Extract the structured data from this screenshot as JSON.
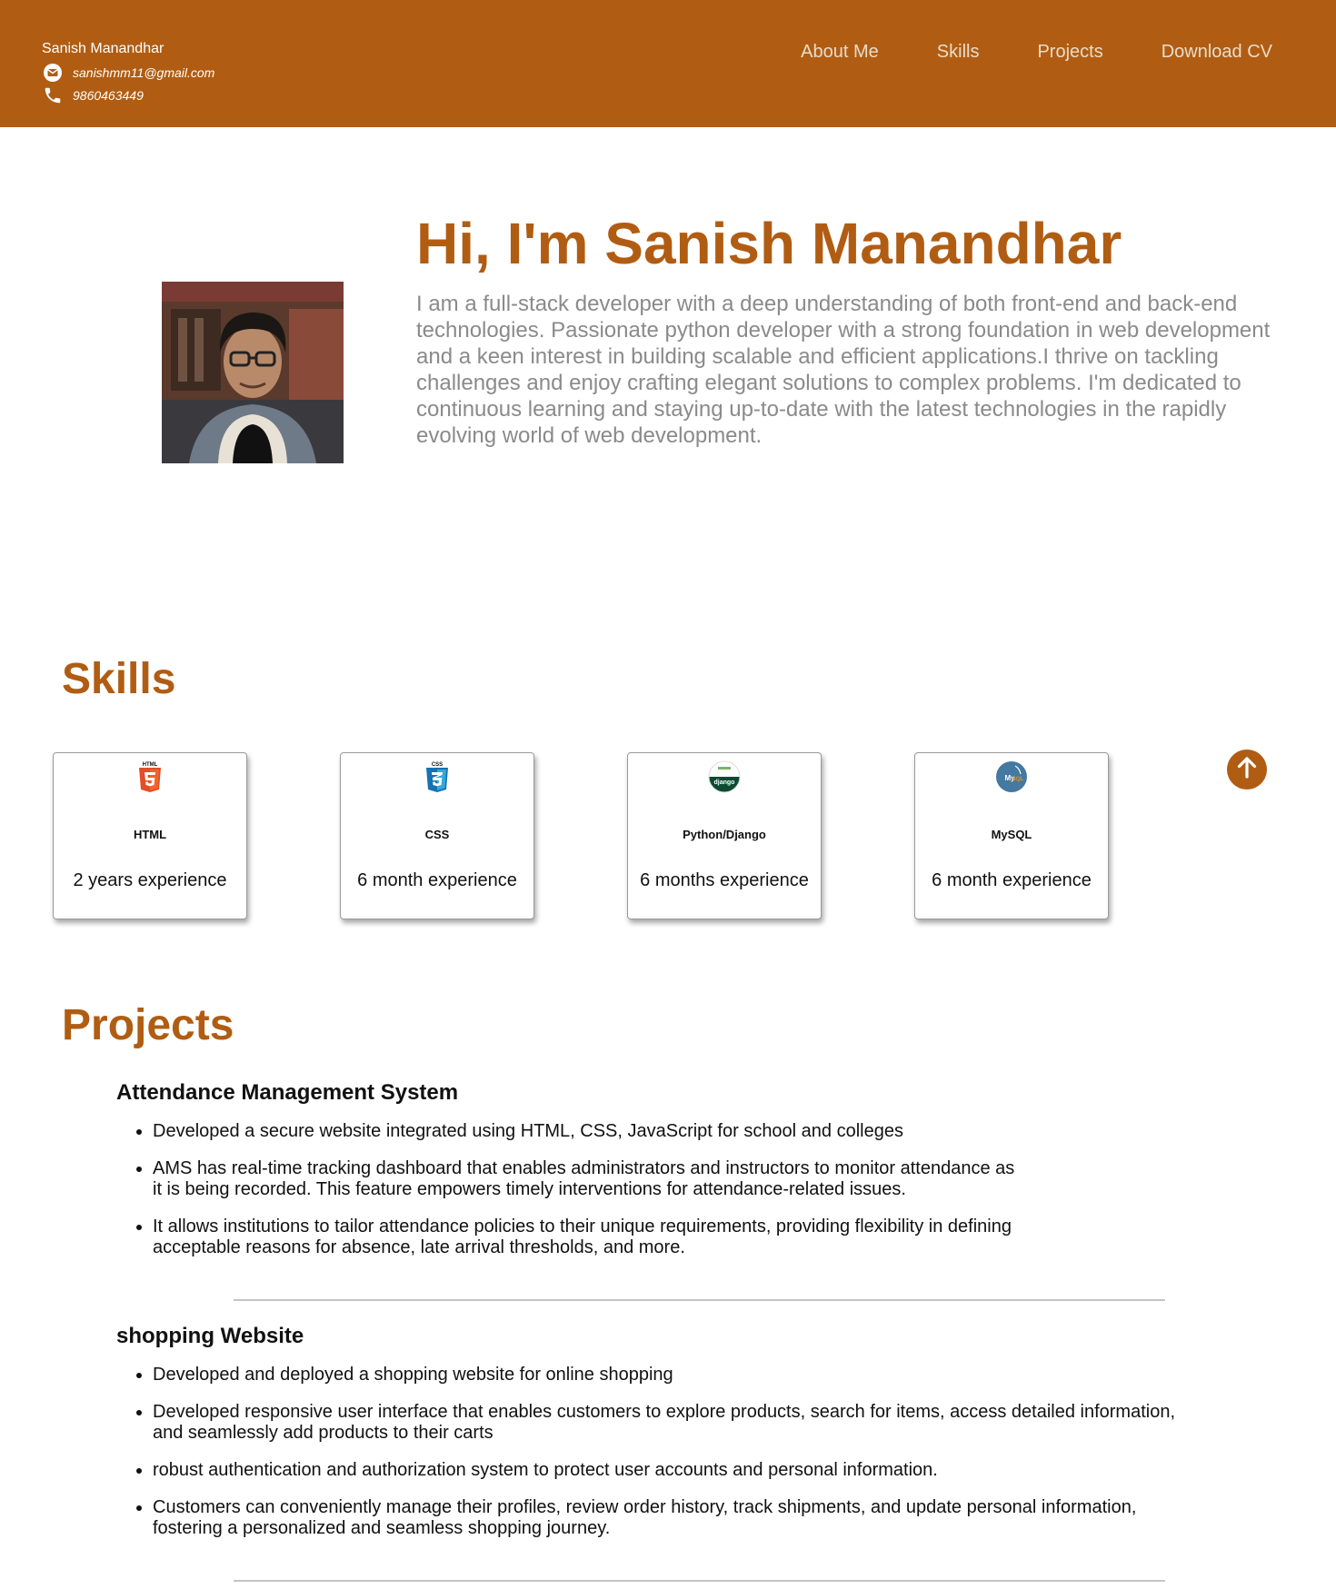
{
  "header": {
    "name": "Sanish Manandhar",
    "email": "sanishmm11@gmail.com",
    "phone": "9860463449",
    "icons": {
      "email": "email-icon",
      "phone": "phone-icon"
    },
    "nav": [
      "About Me",
      "Skills",
      "Projects",
      "Download CV"
    ]
  },
  "hero": {
    "title": "Hi, I'm Sanish Manandhar",
    "description": "I am a full-stack developer with a deep understanding of both front-end and back-end technologies. Passionate python developer with a strong foundation in web development and a keen interest in building scalable and efficient applications.I thrive on tackling challenges and enjoy crafting elegant solutions to complex problems. I'm dedicated to continuous learning and staying up-to-date with the latest technologies in the rapidly evolving world of web development."
  },
  "skills": {
    "title": "Skills",
    "items": [
      {
        "name": "HTML",
        "experience": "2 years experience",
        "icon": "html5-logo"
      },
      {
        "name": "CSS",
        "experience": "6 month experience",
        "icon": "css3-logo"
      },
      {
        "name": "Python/Django",
        "experience": "6 months experience",
        "icon": "django-logo"
      },
      {
        "name": "MySQL",
        "experience": "6 month experience",
        "icon": "mysql-logo"
      }
    ],
    "scroll_top_icon": "arrow-up-icon"
  },
  "projects": {
    "title": "Projects",
    "items": [
      {
        "title": "Attendance Management System",
        "bullets": [
          "Developed a secure website integrated using HTML, CSS, JavaScript for school and colleges",
          "AMS has real-time tracking dashboard that enables administrators and instructors to monitor attendance as it is being recorded. This feature empowers timely interventions for attendance-related issues.",
          "It allows institutions to tailor attendance policies to their unique requirements, providing flexibility in defining acceptable reasons for absence, late arrival thresholds, and more."
        ]
      },
      {
        "title": "shopping Website",
        "bullets": [
          "Developed and deployed a shopping website for online shopping",
          "Developed responsive user interface that enables customers to explore products, search for items, access detailed information, and seamlessly add products to their carts",
          "robust authentication and authorization system to protect user accounts and personal information.",
          "Customers can conveniently manage their profiles, review order history, track shipments, and update personal information, fostering a personalized and seamless shopping journey."
        ]
      }
    ]
  },
  "colors": {
    "accent": "#b05d13",
    "muted_text": "#8a8a8a",
    "nav_text": "#eadcc9"
  }
}
